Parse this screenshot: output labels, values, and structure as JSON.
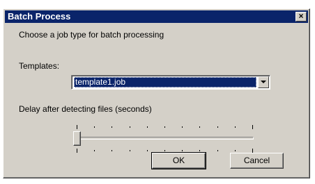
{
  "window": {
    "title": "Batch Process",
    "close_glyph": "×"
  },
  "instructions": "Choose a job type for batch processing",
  "templates": {
    "label": "Templates:",
    "selected": "template1.job"
  },
  "delay": {
    "label": "Delay after detecting files (seconds)",
    "slider_value_fraction": 0.0,
    "tick_count": 11
  },
  "buttons": {
    "ok": "OK",
    "cancel": "Cancel"
  },
  "colors": {
    "titlebar": "#0a246a",
    "face": "#d4d0c8",
    "selection": "#0a246a"
  },
  "icons": {
    "close": "close-icon",
    "dropdown": "chevron-down-icon"
  }
}
